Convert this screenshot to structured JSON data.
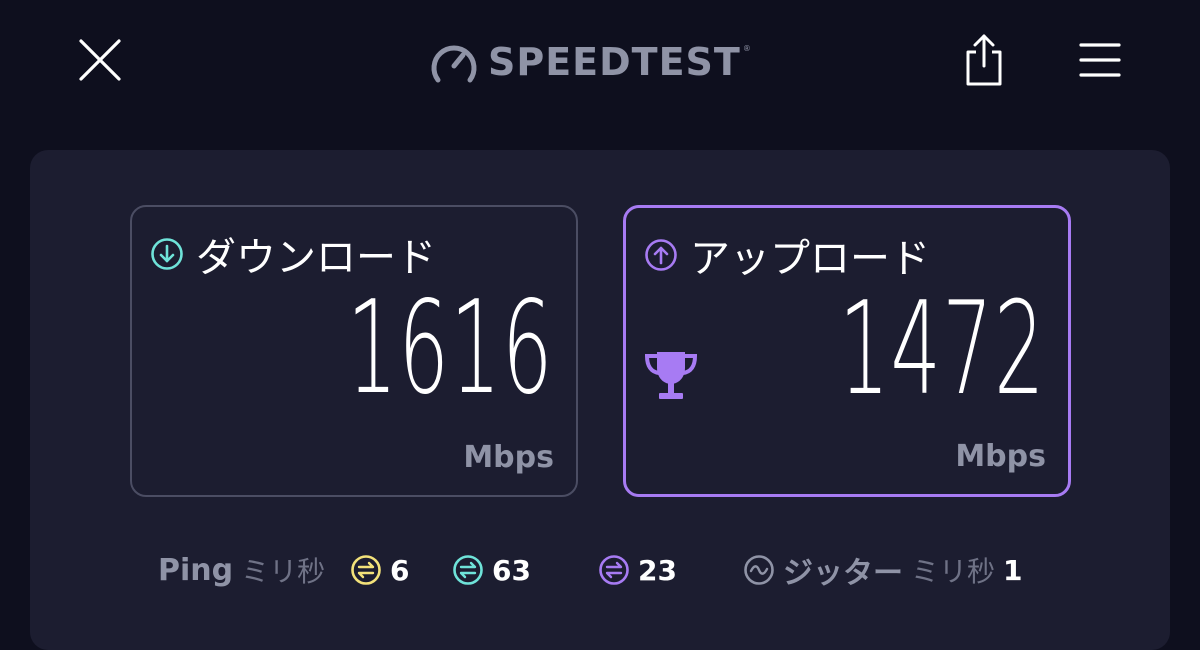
{
  "header": {
    "brand": "SPEEDTEST",
    "trademark": "®",
    "close_icon": "close-icon",
    "share_icon": "share-icon",
    "menu_icon": "menu-icon"
  },
  "download": {
    "title": "ダウンロード",
    "value": "1616",
    "unit": "Mbps",
    "icon": "download-arrow-icon",
    "accent": "#6fe3d9"
  },
  "upload": {
    "title": "アップロード",
    "value": "1472",
    "unit": "Mbps",
    "icon": "upload-arrow-icon",
    "badge_icon": "trophy-icon",
    "accent": "#a77bf3"
  },
  "latency": {
    "ping_label": "Ping",
    "ping_unit": "ミリ秒",
    "idle": "6",
    "download": "63",
    "upload": "23",
    "jitter_label": "ジッター",
    "jitter_unit": "ミリ秒",
    "jitter": "1",
    "colors": {
      "idle": "#f3e27a",
      "download": "#6fe3d9",
      "upload": "#a77bf3"
    }
  }
}
